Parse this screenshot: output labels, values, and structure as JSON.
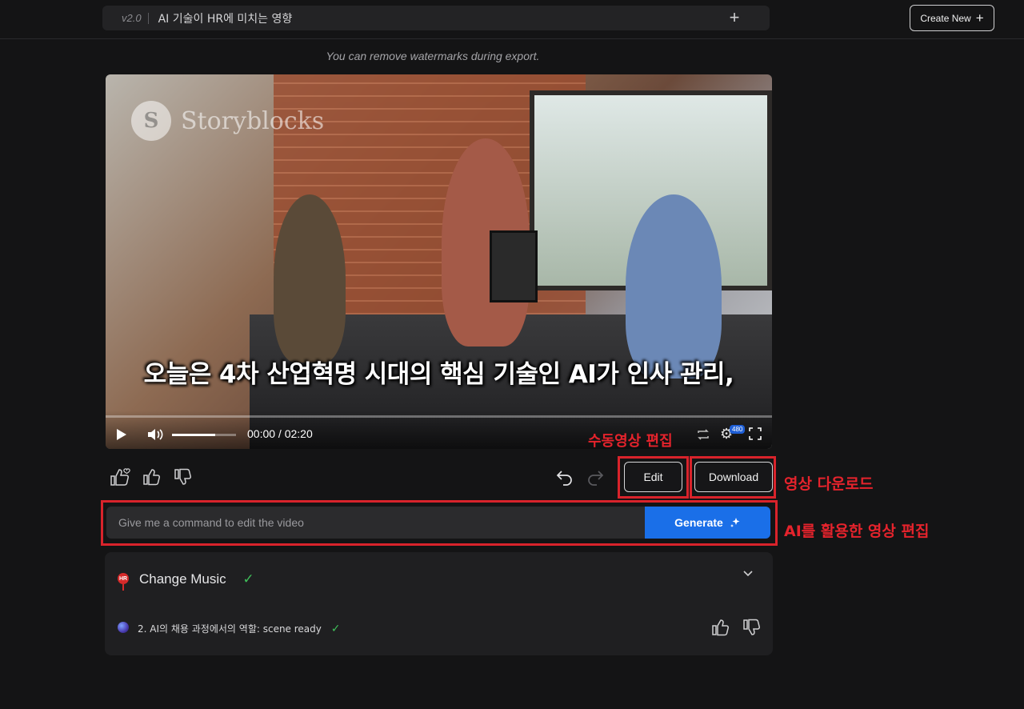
{
  "header": {
    "version": "v2.0",
    "title": "AI 기술이 HR에 미치는 영향",
    "create_new_label": "Create New"
  },
  "watermark_note": "You can remove watermarks during export.",
  "video": {
    "watermark_brand": "Storyblocks",
    "subtitle": "오늘은 4차 산업혁명 시대의 핵심 기술인 AI가 인사 관리,",
    "time": "00:00 / 02:20",
    "quality_badge": "480",
    "volume_level": 0.67,
    "progress": 0.0
  },
  "annotations": {
    "manual_edit": "수동영상 편집",
    "download": "영상 다운로드",
    "ai_edit": "AI를 활용한 영상 편집"
  },
  "actions": {
    "edit_label": "Edit",
    "download_label": "Download"
  },
  "command": {
    "placeholder": "Give me a command to edit the video",
    "generate_label": "Generate"
  },
  "panel": {
    "badge": "HR",
    "title": "Change Music",
    "scene_text": "2. AI의 채용 과정에서의 역할: scene ready"
  },
  "colors": {
    "accent_blue": "#1a6fe8",
    "annotation_red": "#e5232c",
    "check_green": "#3fbf5a"
  }
}
